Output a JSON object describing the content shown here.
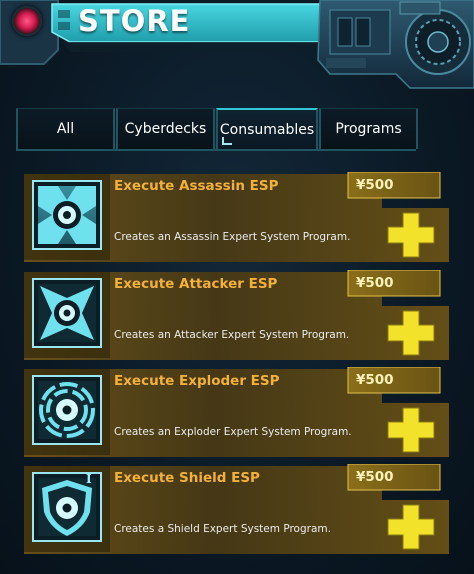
{
  "header": {
    "title": "STORE"
  },
  "tabs": [
    {
      "label": "All",
      "active": false
    },
    {
      "label": "Cyberdecks",
      "active": false
    },
    {
      "label": "Consumables",
      "active": true
    },
    {
      "label": "Programs",
      "active": false
    }
  ],
  "items": [
    {
      "name": "Execute Assassin ESP",
      "price": "¥500",
      "description": "Creates an Assassin Expert System Program.",
      "icon": "assassin-esp-icon"
    },
    {
      "name": "Execute Attacker ESP",
      "price": "¥500",
      "description": "Creates an Attacker Expert System Program.",
      "icon": "attacker-esp-icon"
    },
    {
      "name": "Execute Exploder ESP",
      "price": "¥500",
      "description": "Creates an Exploder Expert System Program.",
      "icon": "exploder-esp-icon"
    },
    {
      "name": "Execute Shield ESP",
      "price": "¥500",
      "description": "Creates a Shield Expert System Program.",
      "icon": "shield-esp-icon",
      "badge": "I"
    }
  ],
  "colors": {
    "accent_cyan": "#32c8d8",
    "item_name": "#f4b13a",
    "plus_yellow": "#f2e32a",
    "panel_gold": "#8a6a1e"
  }
}
